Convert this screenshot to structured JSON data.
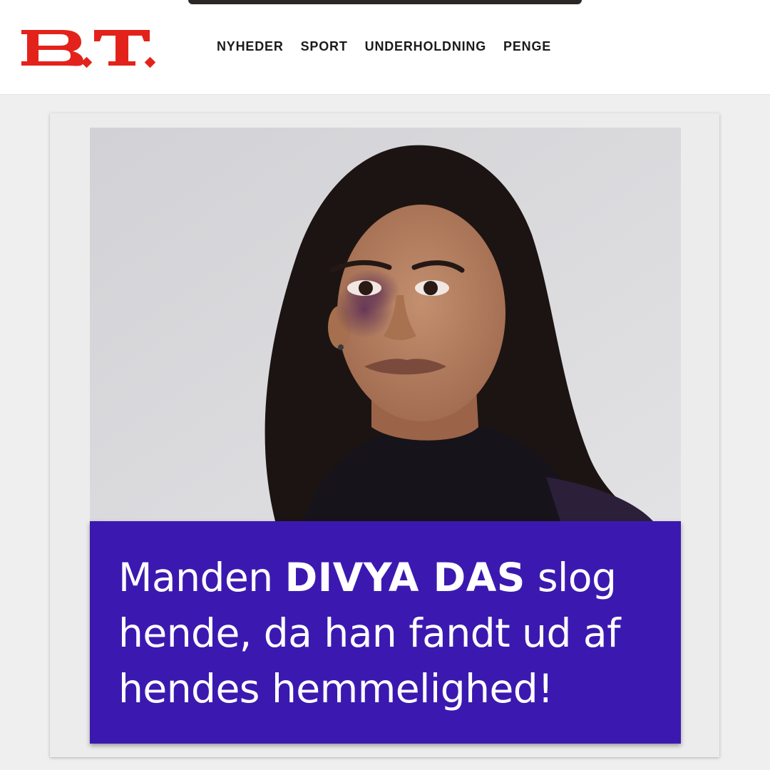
{
  "site": {
    "logo_text": "B.T.",
    "brand_color": "#e3231b"
  },
  "nav": {
    "items": [
      {
        "label": "NYHEDER"
      },
      {
        "label": "SPORT"
      },
      {
        "label": "UNDERHOLDNING"
      },
      {
        "label": "PENGE"
      }
    ]
  },
  "article": {
    "image": {
      "subject": "portrait of woman with bruised eye"
    },
    "headline": {
      "before": "Manden ",
      "name": "DIVYA DAS",
      "after": " slog hende, da han fandt ud af hendes hemmelighed!"
    },
    "caption_color": "#3b19b0"
  }
}
